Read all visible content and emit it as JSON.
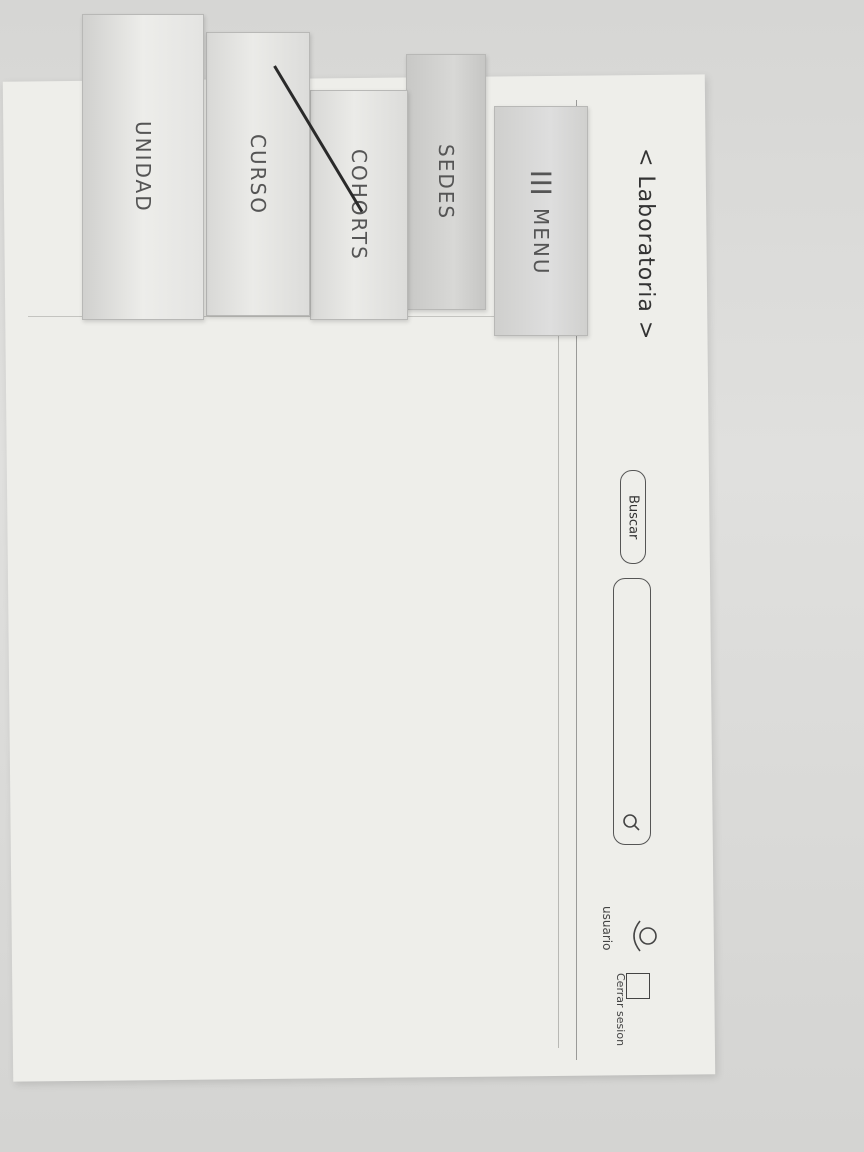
{
  "header": {
    "logo_text": "< Laboratoria >",
    "search_button_label": "Buscar",
    "search_input_value": "",
    "user_label": "usuario",
    "logout_label": "Cerrar sesion"
  },
  "tabs": [
    {
      "label": "MENU",
      "icon": "hamburger-icon"
    },
    {
      "label": "SEDES"
    },
    {
      "label": "COHORTS"
    },
    {
      "label": "CURSO"
    },
    {
      "label": "UNIDAD"
    }
  ],
  "colors": {
    "paper": "#eeeeea",
    "pencil": "#555555",
    "tab_gray": "#d8d8d6"
  }
}
